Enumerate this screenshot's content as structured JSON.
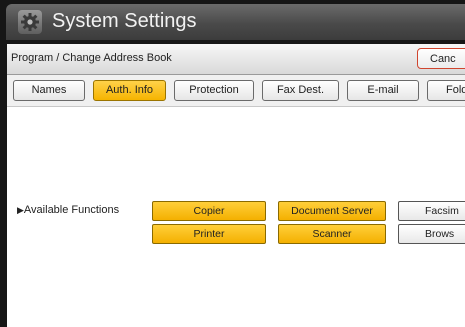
{
  "window": {
    "title": "System Settings"
  },
  "header": {
    "title": "Program / Change Address Book",
    "cancel_label": "Canc"
  },
  "tabs": [
    {
      "label": "Names",
      "active": false
    },
    {
      "label": "Auth. Info",
      "active": true
    },
    {
      "label": "Protection",
      "active": false
    },
    {
      "label": "Fax Dest.",
      "active": false
    },
    {
      "label": "E-mail",
      "active": false
    },
    {
      "label": "Fold",
      "active": false
    }
  ],
  "functions": {
    "label": "Available Functions",
    "items": [
      {
        "label": "Copier",
        "selected": true
      },
      {
        "label": "Document Server",
        "selected": true
      },
      {
        "label": "Facsim",
        "selected": false
      },
      {
        "label": "Printer",
        "selected": true
      },
      {
        "label": "Scanner",
        "selected": true
      },
      {
        "label": "Brows",
        "selected": false
      }
    ]
  },
  "icons": {
    "title_icon": "gear-icon",
    "label_arrow": "triangle-right-icon"
  },
  "colors": {
    "selected": "#f6b400",
    "cancel_border": "#d0452e"
  }
}
